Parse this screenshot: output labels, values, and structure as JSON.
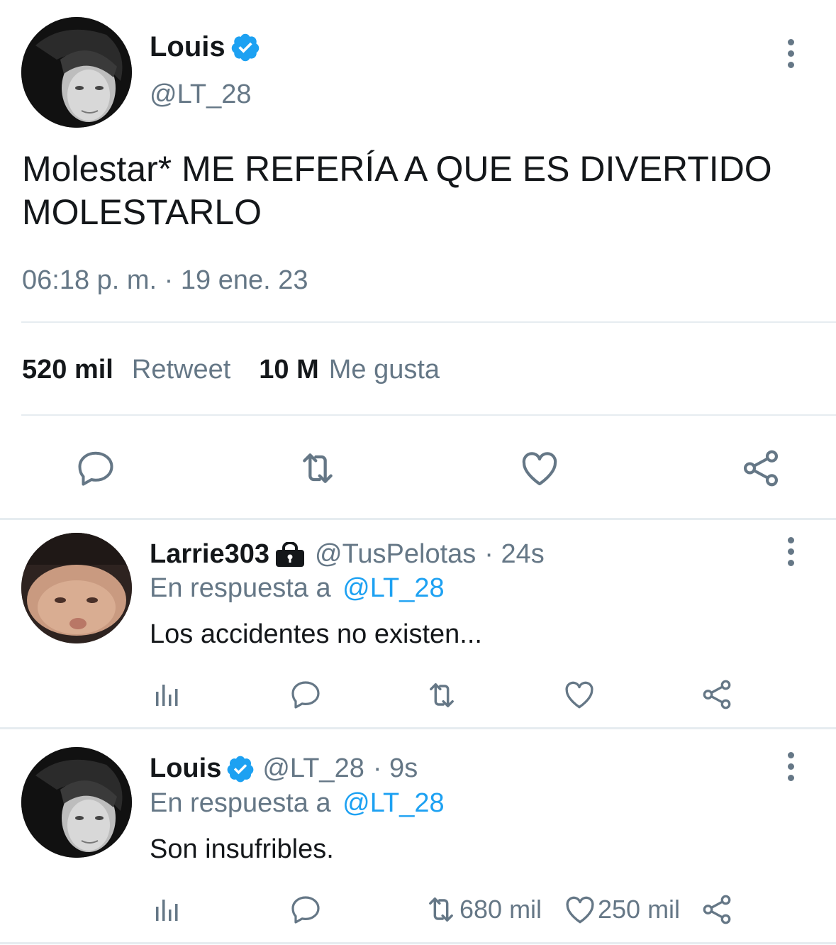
{
  "main_tweet": {
    "author_name": "Louis",
    "author_handle": "@LT_28",
    "text": "Molestar* ME REFERÍA A QUE ES DIVERTIDO MOLESTARLO",
    "timestamp": "06:18 p. m. · 19 ene. 23",
    "retweets_count": "520 mil",
    "retweets_label": "Retweet",
    "likes_count": "10 M",
    "likes_label": "Me gusta"
  },
  "replies": [
    {
      "author_name": "Larrie303",
      "locked": true,
      "author_handle": "@TusPelotas",
      "time": "· 24s",
      "reply_prefix": "En respuesta a",
      "reply_to": "@LT_28",
      "text": "Los accidentes no existen...",
      "retweets": "",
      "likes": ""
    },
    {
      "author_name": "Louis",
      "verified": true,
      "author_handle": "@LT_28",
      "time": "· 9s",
      "reply_prefix": "En respuesta a",
      "reply_to": "@LT_28",
      "text": "Son insufribles.",
      "retweets": "680 mil",
      "likes": "250 mil"
    }
  ],
  "colors": {
    "accent": "#1da1f2",
    "text": "#14171a",
    "secondary": "#657786",
    "divider": "#e6ecf0"
  },
  "icons": [
    "verified-badge-icon",
    "lock-icon",
    "more-icon",
    "reply-icon",
    "retweet-icon",
    "like-icon",
    "share-icon",
    "analytics-icon"
  ]
}
